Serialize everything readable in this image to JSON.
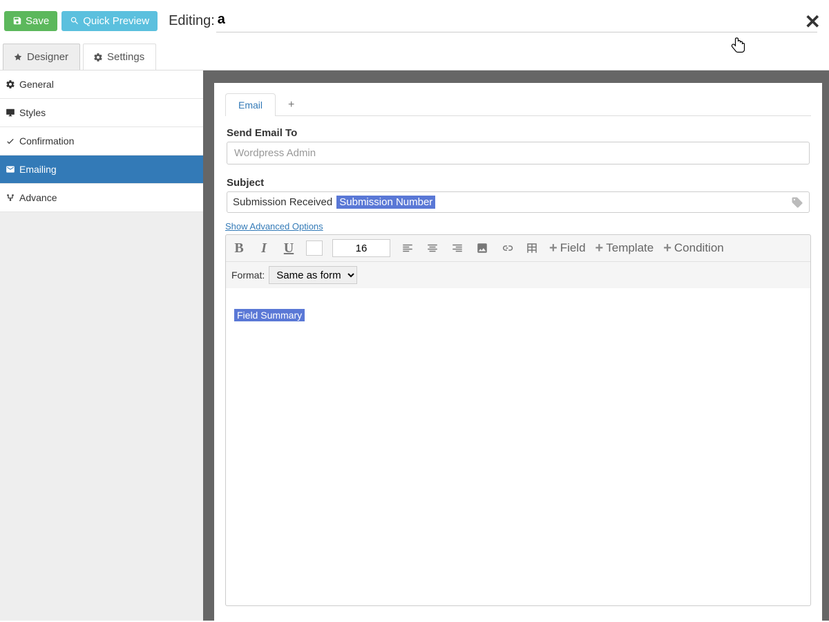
{
  "topbar": {
    "save_label": "Save",
    "preview_label": "Quick Preview",
    "editing_label": "Editing:",
    "editing_value": "a"
  },
  "main_tabs": {
    "designer": "Designer",
    "settings": "Settings"
  },
  "sidebar": {
    "general": "General",
    "styles": "Styles",
    "confirmation": "Confirmation",
    "emailing": "Emailing",
    "advance": "Advance"
  },
  "inner": {
    "tab_email": "Email",
    "send_to_label": "Send Email To",
    "send_to_placeholder": "Wordpress Admin",
    "subject_label": "Subject",
    "subject_text": "Submission Received",
    "subject_token": "Submission Number",
    "adv_link": "Show Advanced Options",
    "font_size": "16",
    "field_btn": "Field",
    "template_btn": "Template",
    "condition_btn": "Condition",
    "format_label": "Format:",
    "format_value": "Same as form",
    "editor_token": "Field Summary"
  }
}
